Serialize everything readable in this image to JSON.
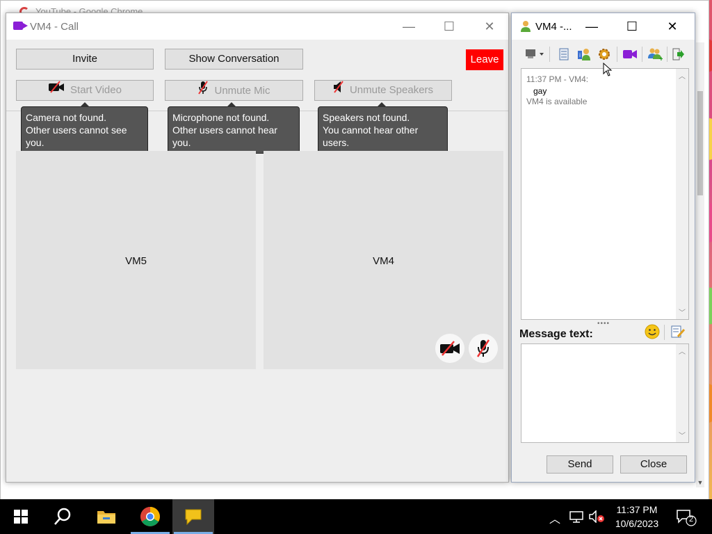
{
  "background_window": {
    "title": "YouTube - Google Chrome"
  },
  "call_window": {
    "title": "VM4 - Call",
    "buttons": {
      "invite": "Invite",
      "show_conversation": "Show Conversation",
      "leave": "Leave",
      "start_video": "Start Video",
      "unmute_mic": "Unmute Mic",
      "unmute_speakers": "Unmute Speakers"
    },
    "tooltips": {
      "camera": [
        "Camera not found.",
        "Other users cannot see you."
      ],
      "microphone": [
        "Microphone not found.",
        "Other users cannot hear you."
      ],
      "speakers": [
        "Speakers not found.",
        "You cannot hear other users."
      ]
    },
    "participants": [
      "VM5",
      "VM4"
    ],
    "colors": {
      "leave": "#ff0000",
      "camera_icon": "#8b1fd6"
    }
  },
  "conversation_window": {
    "title": "VM4 -...",
    "history": {
      "timestamp": "11:37 PM - VM4:",
      "message": "gay",
      "status": "VM4 is available"
    },
    "message_label": "Message text:",
    "send_label": "Send",
    "close_label": "Close"
  },
  "taskbar": {
    "time": "11:37 PM",
    "date": "10/6/2023",
    "notification_count": "2"
  }
}
